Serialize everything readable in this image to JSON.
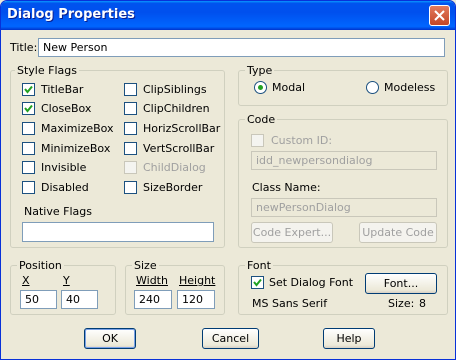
{
  "window": {
    "title": "Dialog Properties"
  },
  "title_field": {
    "label": "Title:",
    "value": "New Person"
  },
  "style_flags": {
    "legend": "Style Flags",
    "left": [
      {
        "label": "TitleBar",
        "checked": true,
        "enabled": true
      },
      {
        "label": "CloseBox",
        "checked": true,
        "enabled": true
      },
      {
        "label": "MaximizeBox",
        "checked": false,
        "enabled": true
      },
      {
        "label": "MinimizeBox",
        "checked": false,
        "enabled": true
      },
      {
        "label": "Invisible",
        "checked": false,
        "enabled": true
      },
      {
        "label": "Disabled",
        "checked": false,
        "enabled": true
      }
    ],
    "right": [
      {
        "label": "ClipSiblings",
        "checked": false,
        "enabled": true
      },
      {
        "label": "ClipChildren",
        "checked": false,
        "enabled": true
      },
      {
        "label": "HorizScrollBar",
        "checked": false,
        "enabled": true
      },
      {
        "label": "VertScrollBar",
        "checked": false,
        "enabled": true
      },
      {
        "label": "ChildDialog",
        "checked": false,
        "enabled": false
      },
      {
        "label": "SizeBorder",
        "checked": false,
        "enabled": true
      }
    ],
    "native_flags_label": "Native Flags",
    "native_flags_value": ""
  },
  "type_group": {
    "legend": "Type",
    "modal_label": "Modal",
    "modeless_label": "Modeless",
    "selected": "Modal"
  },
  "code_group": {
    "legend": "Code",
    "custom_id_label": "Custom ID:",
    "custom_id_value": "idd_newpersondialog",
    "class_name_label": "Class Name:",
    "class_name_value": "newPersonDialog",
    "code_expert_label": "Code Expert...",
    "update_code_label": "Update Code"
  },
  "position_group": {
    "legend": "Position",
    "x_label": "X",
    "y_label": "Y",
    "x_value": "50",
    "y_value": "40"
  },
  "size_group": {
    "legend": "Size",
    "width_label": "Width",
    "height_label": "Height",
    "width_value": "240",
    "height_value": "120"
  },
  "font_group": {
    "legend": "Font",
    "set_font_label": "Set Dialog Font",
    "set_font_checked": true,
    "font_button_label": "Font...",
    "font_name": "MS Sans Serif",
    "size_label": "Size:",
    "size_value": "8"
  },
  "buttons": {
    "ok": "OK",
    "cancel": "Cancel",
    "help": "Help"
  }
}
